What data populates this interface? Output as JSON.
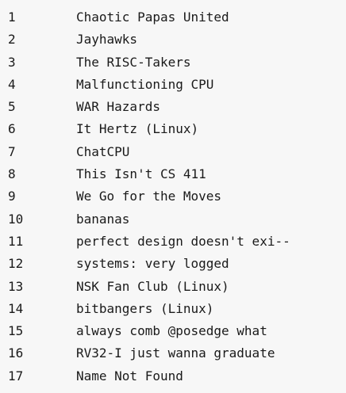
{
  "rankings": [
    {
      "rank": "1",
      "team": "Chaotic Papas United"
    },
    {
      "rank": "2",
      "team": "Jayhawks"
    },
    {
      "rank": "3",
      "team": "The RISC-Takers"
    },
    {
      "rank": "4",
      "team": "Malfunctioning CPU"
    },
    {
      "rank": "5",
      "team": "WAR Hazards"
    },
    {
      "rank": "6",
      "team": "It Hertz (Linux)"
    },
    {
      "rank": "7",
      "team": "ChatCPU"
    },
    {
      "rank": "8",
      "team": "This Isn't CS 411"
    },
    {
      "rank": "9",
      "team": "We Go for the Moves"
    },
    {
      "rank": "10",
      "team": "bananas"
    },
    {
      "rank": "11",
      "team": "perfect design doesn't exi--"
    },
    {
      "rank": "12",
      "team": "systems: very logged"
    },
    {
      "rank": "13",
      "team": "NSK Fan Club (Linux)"
    },
    {
      "rank": "14",
      "team": "bitbangers (Linux)"
    },
    {
      "rank": "15",
      "team": "always comb @posedge what"
    },
    {
      "rank": "16",
      "team": "RV32-I just wanna graduate"
    },
    {
      "rank": "17",
      "team": "Name Not Found"
    }
  ]
}
